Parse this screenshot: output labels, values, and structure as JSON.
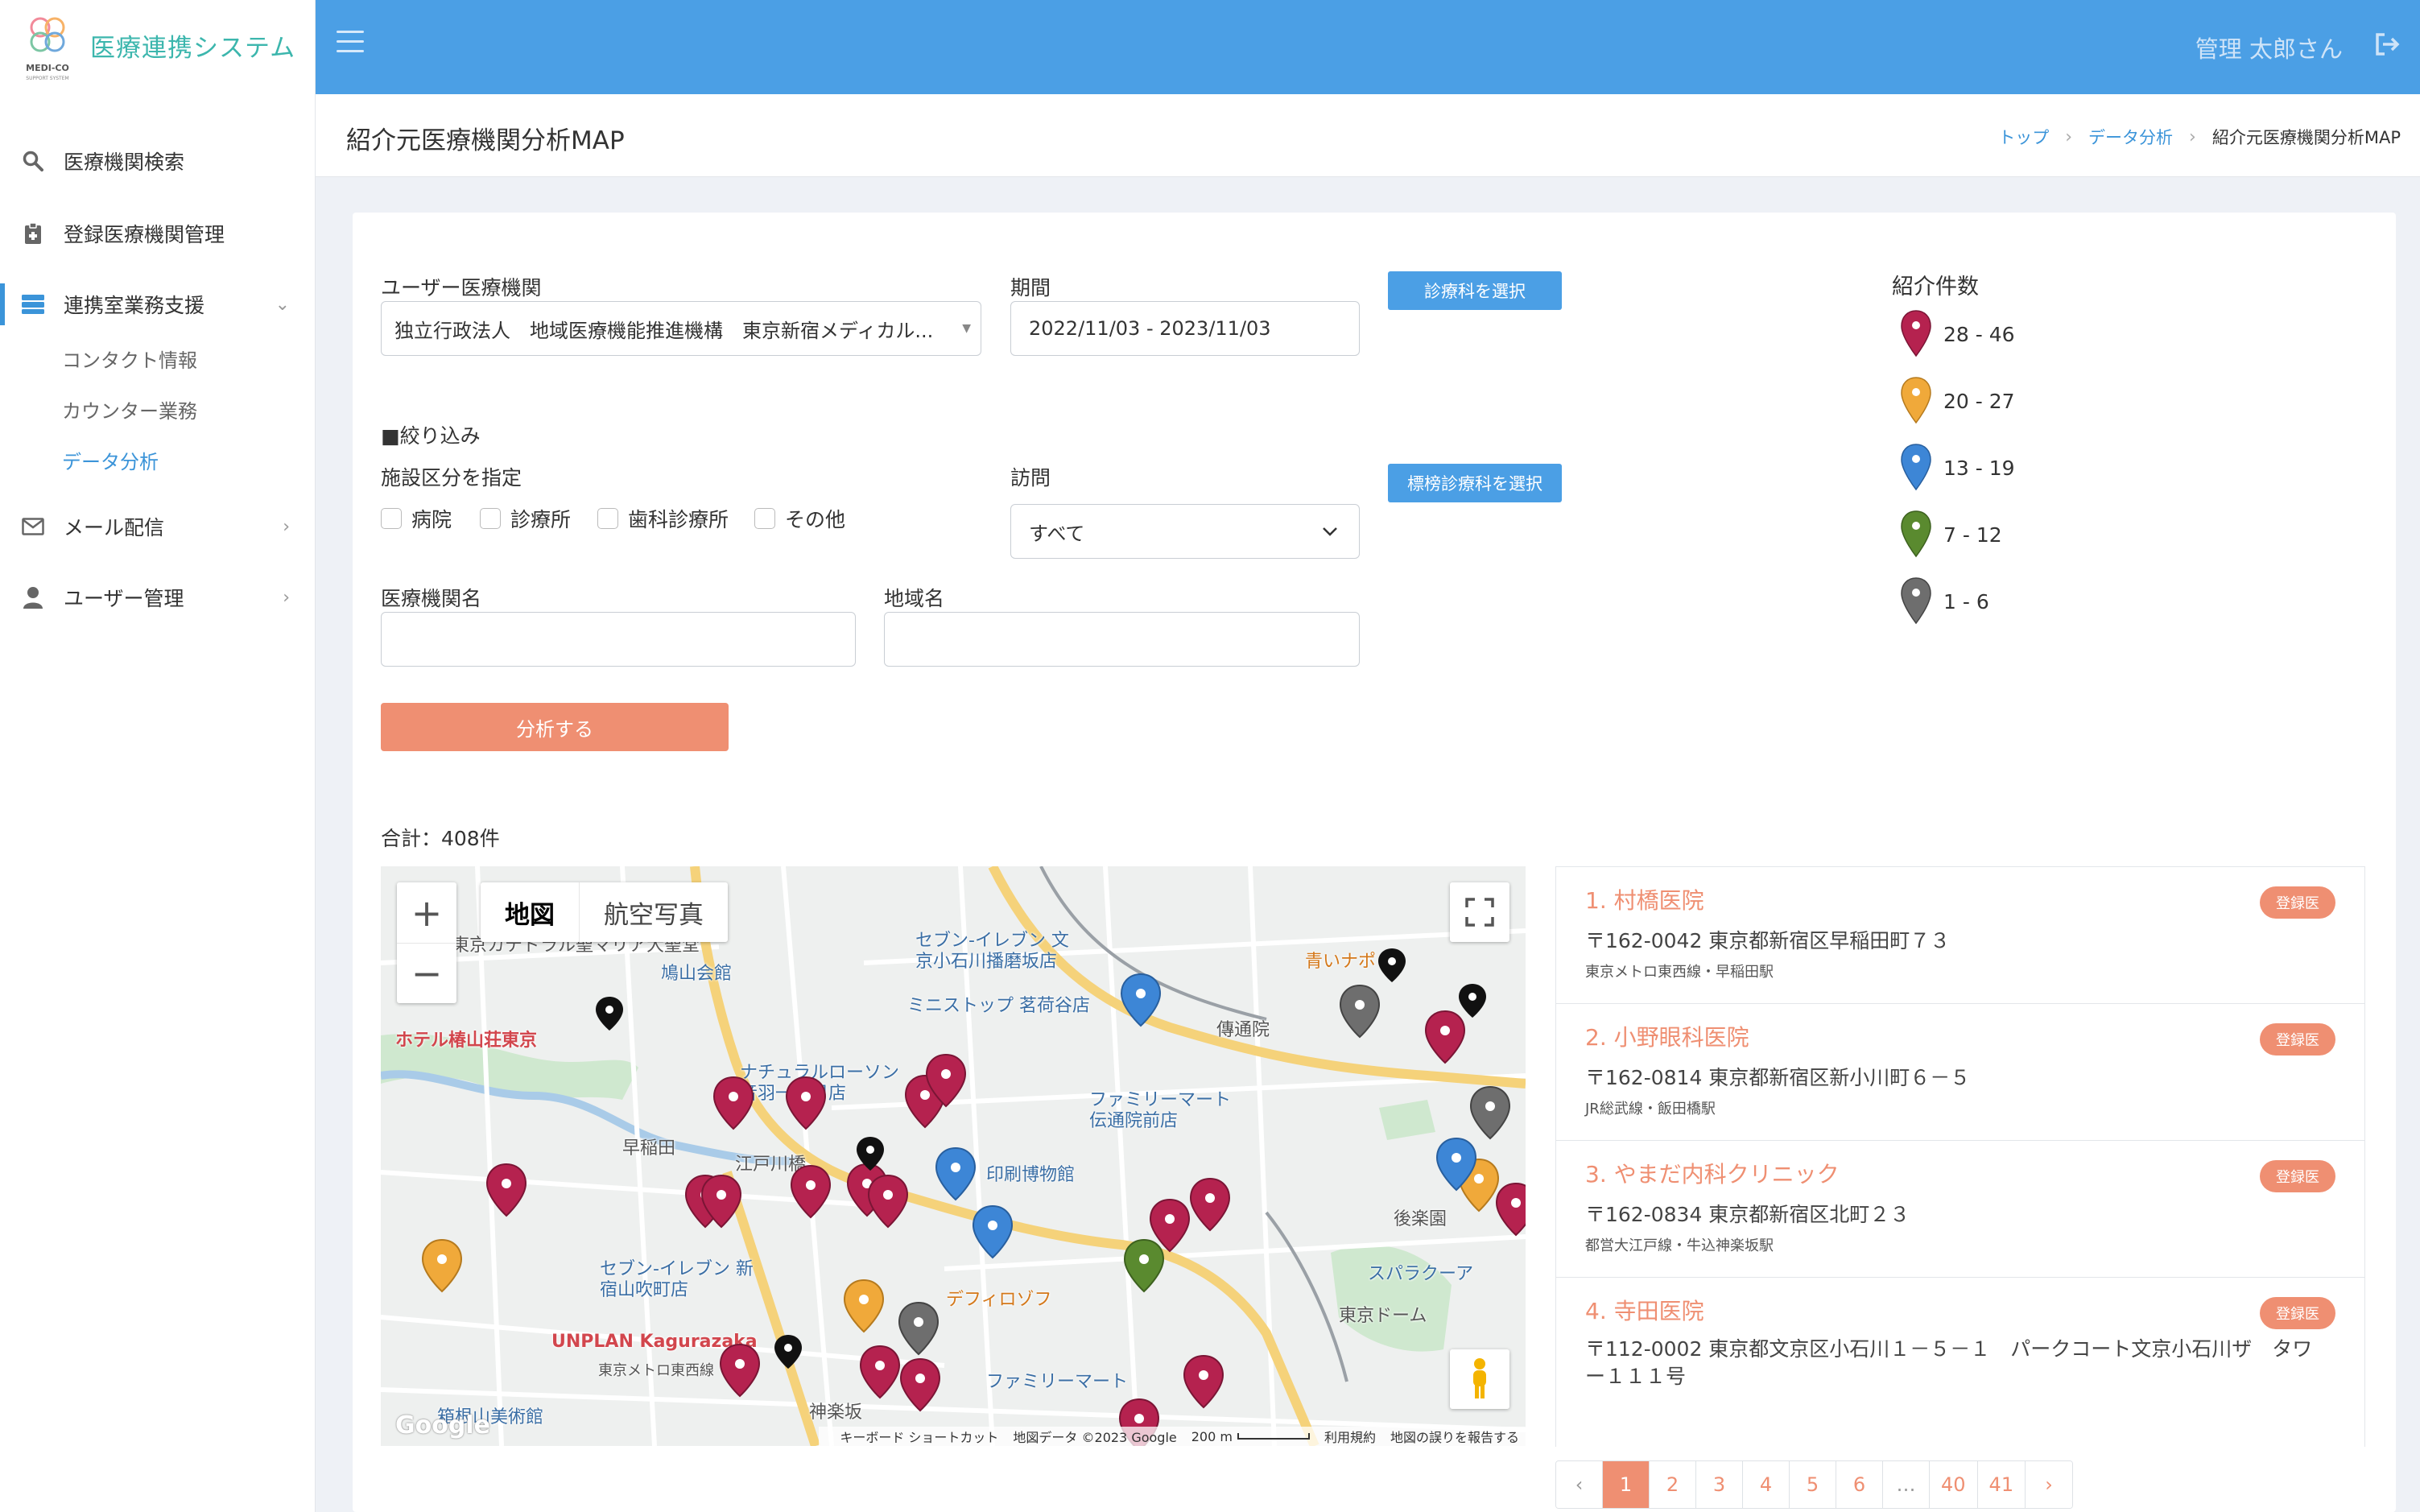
{
  "app": {
    "logo_text": "MEDI-CO",
    "logo_subtext": "SUPPORT SYSTEM",
    "title": "医療連携システム"
  },
  "sidebar": {
    "items": [
      {
        "label": "医療機関検索",
        "icon": "search-icon"
      },
      {
        "label": "登録医療機関管理",
        "icon": "clipboard-icon"
      },
      {
        "label": "連携室業務支援",
        "icon": "server-icon"
      },
      {
        "label": "メール配信",
        "icon": "mail-icon"
      },
      {
        "label": "ユーザー管理",
        "icon": "user-icon"
      }
    ],
    "subitems": [
      {
        "label": "コンタクト情報"
      },
      {
        "label": "カウンター業務"
      },
      {
        "label": "データ分析"
      }
    ]
  },
  "topbar": {
    "user": "管理 太郎さん"
  },
  "header": {
    "title": "紹介元医療機関分析MAP",
    "breadcrumb": [
      "トップ",
      "データ分析",
      "紹介元医療機関分析MAP"
    ]
  },
  "form": {
    "user_institution_label": "ユーザー医療機関",
    "user_institution_value": "独立行政法人　地域医療機能推進機構　東京新宿メディカル...",
    "period_label": "期間",
    "period_value": "2022/11/03 - 2023/11/03",
    "dept_button": "診療科を選択",
    "filter_label": "■絞り込み",
    "facility_type_label": "施設区分を指定",
    "facility_types": [
      "病院",
      "診療所",
      "歯科診療所",
      "その他"
    ],
    "visit_label": "訪問",
    "visit_value": "すべて",
    "std_dept_button": "標榜診療科を選択",
    "institution_name_label": "医療機関名",
    "region_label": "地域名",
    "analyze_button": "分析する"
  },
  "legend": {
    "title": "紹介件数",
    "ranges": [
      {
        "label": "28 - 46",
        "color": "#b5224f"
      },
      {
        "label": "20 - 27",
        "color": "#f0a93a"
      },
      {
        "label": "13 - 19",
        "color": "#3d86d6"
      },
      {
        "label": "7 - 12",
        "color": "#5a8a2f"
      },
      {
        "label": "1 - 6",
        "color": "#6e6e6e"
      }
    ]
  },
  "total": "合計：408件",
  "map": {
    "map_button": "地図",
    "satellite_button": "航空写真",
    "zoom_in": "+",
    "zoom_out": "−",
    "google": "Google",
    "attribution": [
      "キーボード ショートカット",
      "地図データ ©2023 Google",
      "200 m",
      "利用規約",
      "地図の誤りを報告する"
    ],
    "labels": [
      "ホテル椿山荘東京",
      "鳩山会館",
      "セブン-イレブン 文京小石川播磨坂店",
      "ミニストップ 茗荷谷店",
      "東京カテドラル聖マリア大聖堂",
      "ナチュラルローソン 音羽一丁目店",
      "印刷博物館",
      "ファミリーマート 伝通院前店",
      "傳通院",
      "江戸川橋",
      "早稲田",
      "セブン-イレブン 新宿山吹町店",
      "UNPLAN Kagurazaka",
      "神楽坂",
      "東京ドーム",
      "スパラクーア",
      "後楽園",
      "青いナポ",
      "デフィロゾフ",
      "ファミリーマート",
      "箱根山美術館",
      "東京メトロ東西線"
    ]
  },
  "results": [
    {
      "name": "1. 村橋医院",
      "badge": "登録医",
      "address": "〒162-0042 東京都新宿区早稲田町７３",
      "station": "東京メトロ東西線・早稲田駅"
    },
    {
      "name": "2. 小野眼科医院",
      "badge": "登録医",
      "address": "〒162-0814 東京都新宿区新小川町６－５",
      "station": "JR総武線・飯田橋駅"
    },
    {
      "name": "3. やまだ内科クリニック",
      "badge": "登録医",
      "address": "〒162-0834 東京都新宿区北町２３",
      "station": "都営大江戸線・牛込神楽坂駅"
    },
    {
      "name": "4. 寺田医院",
      "badge": "登録医",
      "address": "〒112-0002 東京都文京区小石川１－５－１　パークコート文京小石川ザ　タワー１１１号",
      "station": ""
    }
  ],
  "pagination": {
    "prev": "‹",
    "pages": [
      "1",
      "2",
      "3",
      "4",
      "5",
      "6",
      "…",
      "40",
      "41"
    ],
    "next": "›",
    "current": "1"
  }
}
